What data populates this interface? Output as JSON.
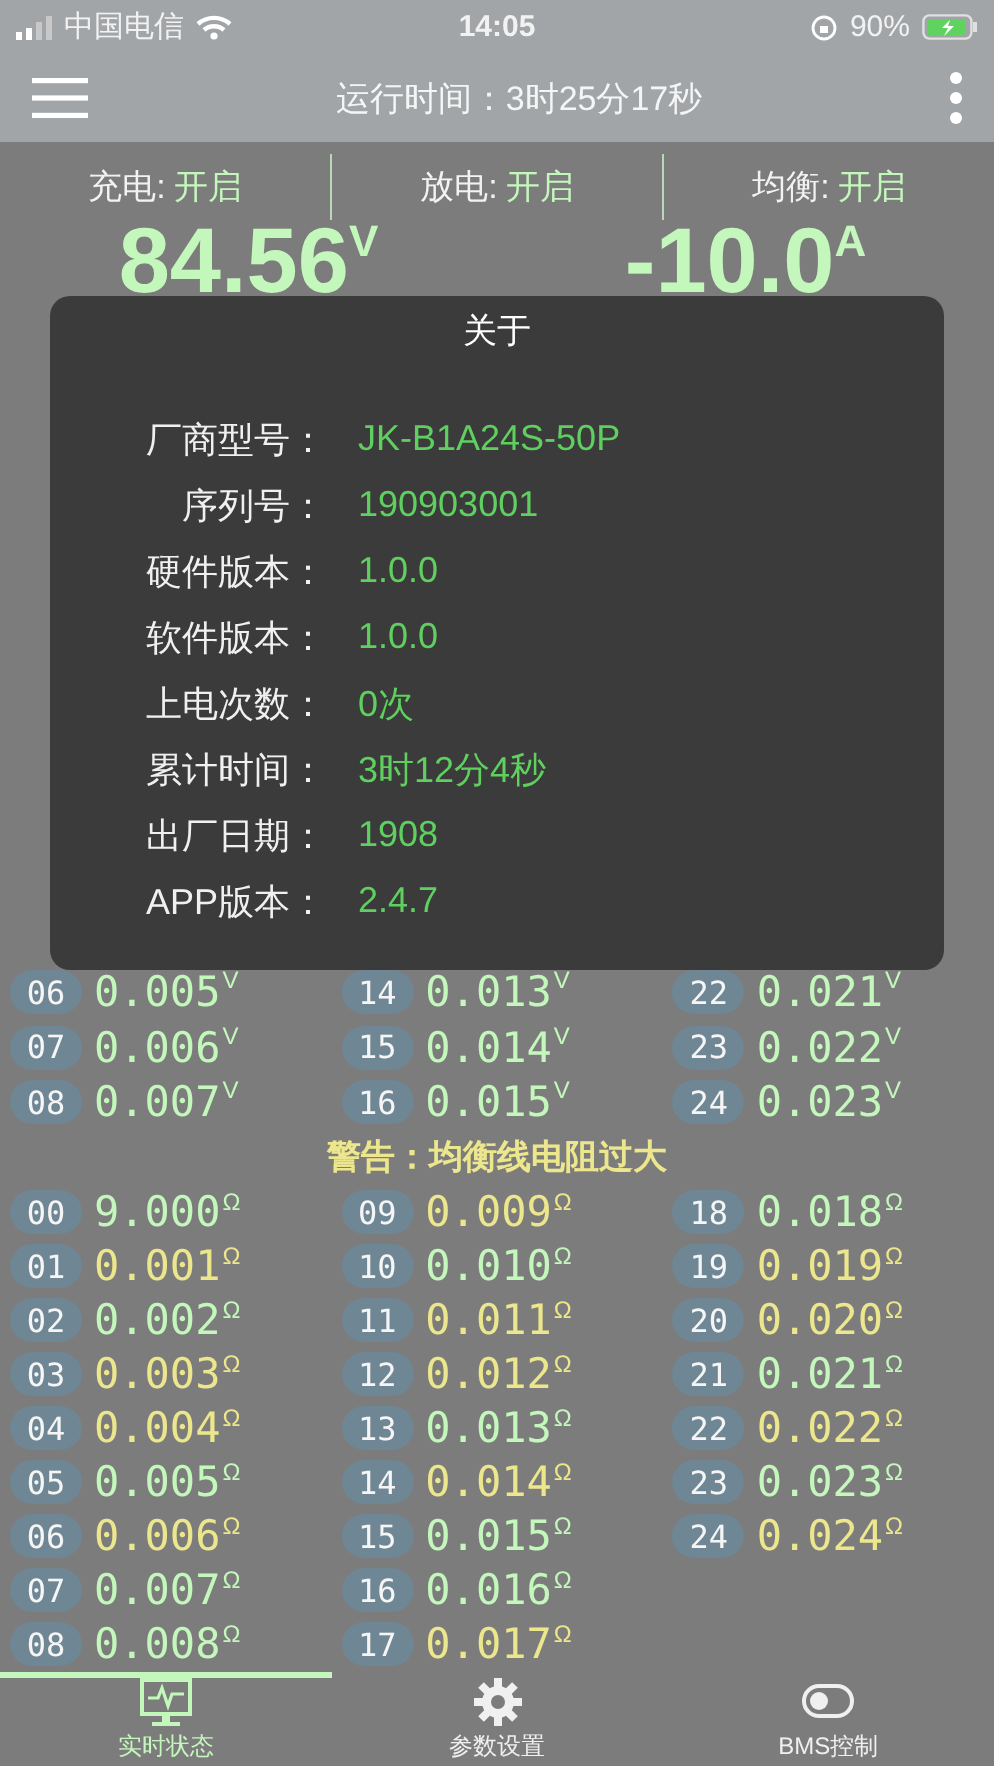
{
  "status_bar": {
    "carrier": "中国电信",
    "time": "14:05",
    "battery": "90%"
  },
  "header": {
    "title": "运行时间：3时25分17秒"
  },
  "switches": [
    {
      "label": "充电:",
      "value": "开启"
    },
    {
      "label": "放电:",
      "value": "开启"
    },
    {
      "label": "均衡:",
      "value": "开启"
    }
  ],
  "readings": [
    {
      "value": "84.56",
      "unit": "V"
    },
    {
      "value": "-10.0",
      "unit": "A"
    }
  ],
  "voltage_cells": [
    {
      "index": "06",
      "value": "0.005",
      "unit": "V"
    },
    {
      "index": "07",
      "value": "0.006",
      "unit": "V"
    },
    {
      "index": "08",
      "value": "0.007",
      "unit": "V"
    },
    {
      "index": "14",
      "value": "0.013",
      "unit": "V"
    },
    {
      "index": "15",
      "value": "0.014",
      "unit": "V"
    },
    {
      "index": "16",
      "value": "0.015",
      "unit": "V"
    },
    {
      "index": "22",
      "value": "0.021",
      "unit": "V"
    },
    {
      "index": "23",
      "value": "0.022",
      "unit": "V"
    },
    {
      "index": "24",
      "value": "0.023",
      "unit": "V"
    }
  ],
  "warning": "警告：均衡线电阻过大",
  "resistance_cells": [
    {
      "index": "00",
      "value": "9.000",
      "unit": "Ω",
      "color": "#c4f7bc"
    },
    {
      "index": "01",
      "value": "0.001",
      "unit": "Ω",
      "color": "#ece68c"
    },
    {
      "index": "02",
      "value": "0.002",
      "unit": "Ω",
      "color": "#c4f7bc"
    },
    {
      "index": "03",
      "value": "0.003",
      "unit": "Ω",
      "color": "#ece68c"
    },
    {
      "index": "04",
      "value": "0.004",
      "unit": "Ω",
      "color": "#ece68c"
    },
    {
      "index": "05",
      "value": "0.005",
      "unit": "Ω",
      "color": "#c4f7bc"
    },
    {
      "index": "06",
      "value": "0.006",
      "unit": "Ω",
      "color": "#ece68c"
    },
    {
      "index": "07",
      "value": "0.007",
      "unit": "Ω",
      "color": "#c4f7bc"
    },
    {
      "index": "08",
      "value": "0.008",
      "unit": "Ω",
      "color": "#c4f7bc"
    },
    {
      "index": "09",
      "value": "0.009",
      "unit": "Ω",
      "color": "#ece68c"
    },
    {
      "index": "10",
      "value": "0.010",
      "unit": "Ω",
      "color": "#c4f7bc"
    },
    {
      "index": "11",
      "value": "0.011",
      "unit": "Ω",
      "color": "#ece68c"
    },
    {
      "index": "12",
      "value": "0.012",
      "unit": "Ω",
      "color": "#ece68c"
    },
    {
      "index": "13",
      "value": "0.013",
      "unit": "Ω",
      "color": "#c4f7bc"
    },
    {
      "index": "14",
      "value": "0.014",
      "unit": "Ω",
      "color": "#ece68c"
    },
    {
      "index": "15",
      "value": "0.015",
      "unit": "Ω",
      "color": "#c4f7bc"
    },
    {
      "index": "16",
      "value": "0.016",
      "unit": "Ω",
      "color": "#c4f7bc"
    },
    {
      "index": "17",
      "value": "0.017",
      "unit": "Ω",
      "color": "#ece68c"
    },
    {
      "index": "18",
      "value": "0.018",
      "unit": "Ω",
      "color": "#c4f7bc"
    },
    {
      "index": "19",
      "value": "0.019",
      "unit": "Ω",
      "color": "#ece68c"
    },
    {
      "index": "20",
      "value": "0.020",
      "unit": "Ω",
      "color": "#ece68c"
    },
    {
      "index": "21",
      "value": "0.021",
      "unit": "Ω",
      "color": "#c4f7bc"
    },
    {
      "index": "22",
      "value": "0.022",
      "unit": "Ω",
      "color": "#ece68c"
    },
    {
      "index": "23",
      "value": "0.023",
      "unit": "Ω",
      "color": "#c4f7bc"
    },
    {
      "index": "24",
      "value": "0.024",
      "unit": "Ω",
      "color": "#ece68c"
    }
  ],
  "tabs": [
    {
      "label": "实时状态",
      "kind": "monitor",
      "selected": true
    },
    {
      "label": "参数设置",
      "kind": "gear",
      "selected": false
    },
    {
      "label": "BMS控制",
      "kind": "toggle",
      "selected": false
    }
  ],
  "dialog": {
    "title": "关于",
    "rows": [
      {
        "label": "厂商型号：",
        "value": "JK-B1A24S-50P"
      },
      {
        "label": "序列号：",
        "value": "190903001"
      },
      {
        "label": "硬件版本：",
        "value": "1.0.0"
      },
      {
        "label": "软件版本：",
        "value": "1.0.0"
      },
      {
        "label": "上电次数：",
        "value": "0次"
      },
      {
        "label": "累计时间：",
        "value": "3时12分4秒"
      },
      {
        "label": "出厂日期：",
        "value": "1908"
      },
      {
        "label": "APP版本：",
        "value": "2.4.7"
      }
    ]
  }
}
